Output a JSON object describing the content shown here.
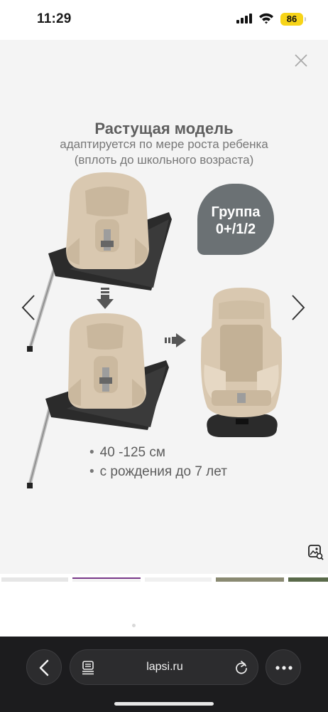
{
  "status_bar": {
    "time": "11:29",
    "battery": "86",
    "battery_color": "#f7d418"
  },
  "viewer": {
    "title": "Растущая модель",
    "subtitle_1": "адаптируется по мере роста ребенка",
    "subtitle_2": "(вплоть до школьного возраста)",
    "badge_line_1": "Группа",
    "badge_line_2": "0+/1/2",
    "specs": [
      "40 -125 см",
      "с рождения до 7 лет"
    ],
    "icons": {
      "close": "close-icon",
      "prev": "chevron-left-icon",
      "next": "chevron-right-icon",
      "visual_lookup": "visual-lookup-icon"
    }
  },
  "browser": {
    "url": "lapsi.ru",
    "icons": [
      "back-icon",
      "reader-icon",
      "reload-icon",
      "more-icon"
    ]
  },
  "colors": {
    "badge": "#6b7174",
    "seat": "#d9c8b0",
    "toolbar": "#1c1c1e",
    "thumb_selected": "#7a3a8a"
  }
}
